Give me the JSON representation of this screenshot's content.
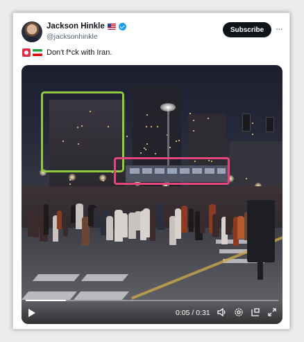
{
  "author": {
    "name": "Jackson Hinkle",
    "handle": "@jacksonhinkle",
    "flag_icon": "us-flag-icon",
    "verified_icon": "verified-badge-icon"
  },
  "actions": {
    "subscribe_label": "Subscribe",
    "more_label": "···"
  },
  "tweet": {
    "text": "Don't f*ck with Iran.",
    "emoji_icons": [
      "red-circle-emoji-icon",
      "iran-flag-icon"
    ]
  },
  "video": {
    "time_label": "0:05 / 0:31",
    "progress_fraction": 0.16,
    "annotation_colors": {
      "green": "#8fcb43",
      "pink": "#e4457a"
    },
    "controls": [
      "play-icon",
      "volume-icon",
      "settings-icon",
      "picture-in-picture-icon",
      "fullscreen-icon"
    ]
  },
  "colors": {
    "accent": "#1d9bf0",
    "text": "#0f1419",
    "secondary": "#536471"
  }
}
